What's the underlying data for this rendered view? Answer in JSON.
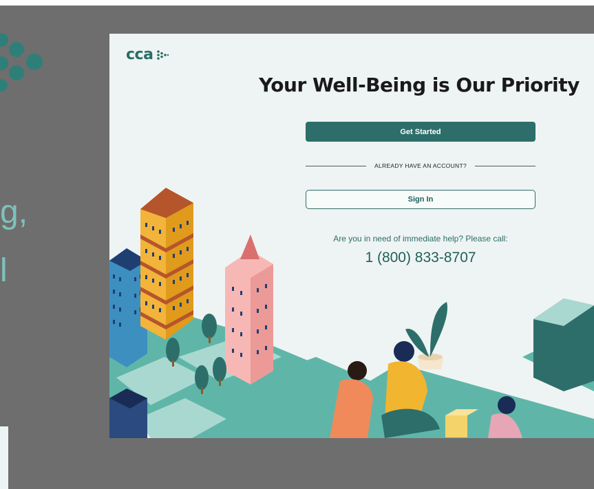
{
  "background": {
    "text_line_1": "g,",
    "text_line_2": "l"
  },
  "app": {
    "logo_text": "cca"
  },
  "hero": {
    "title": "Your Well-Being is Our Priority"
  },
  "actions": {
    "get_started_label": "Get Started",
    "divider_label": "ALREADY HAVE AN ACCOUNT?",
    "sign_in_label": "Sign In"
  },
  "help": {
    "prompt": "Are you in need of immediate help?  Please call:",
    "phone": "1 (800) 833-8707"
  },
  "colors": {
    "brand": "#2d6e6a",
    "page_background": "#eef4f3",
    "outer_background": "#6e6e6e",
    "accent_light": "#7fc1bb"
  }
}
